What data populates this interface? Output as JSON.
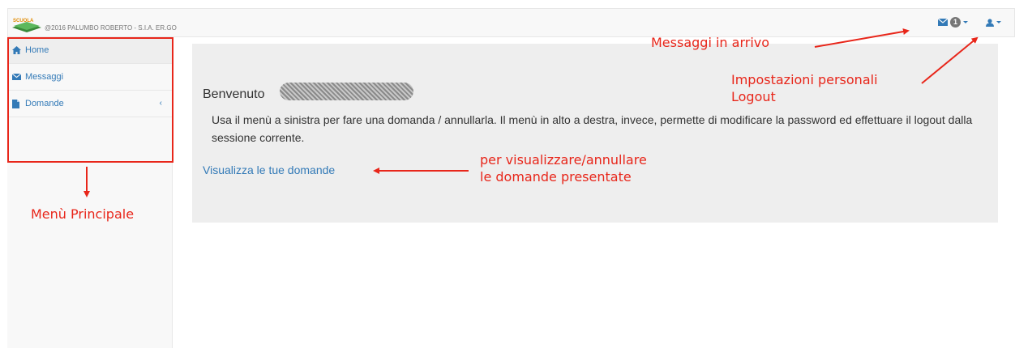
{
  "app": {
    "copyright": "@2016 PALUMBO ROBERTO - S.I.A. ER.GO",
    "logo_text": "SCUOLA"
  },
  "topnav": {
    "messages_count": "1",
    "messages_icon": "envelope-icon",
    "user_icon": "user-icon"
  },
  "sidebar": {
    "items": [
      {
        "label": "Home",
        "icon": "home-icon",
        "active": true
      },
      {
        "label": "Messaggi",
        "icon": "envelope-icon",
        "active": false
      },
      {
        "label": "Domande",
        "icon": "file-icon",
        "active": false,
        "expand_glyph": "‹"
      }
    ]
  },
  "main": {
    "welcome": "Benvenuto",
    "description": "Usa il menù a sinistra per fare una domanda / annullarla. Il menù in alto a destra, invece, permette di modificare la password ed effettuare il logout dalla sessione corrente.",
    "link": "Visualizza le tue domande"
  },
  "annotations": {
    "messages": "Messaggi in arrivo",
    "personal_line1": "Impostazioni personali",
    "personal_line2": "Logout",
    "domande_line1": "per visualizzare/annullare",
    "domande_line2": "le domande presentate",
    "menu": "Menù Principale"
  },
  "colors": {
    "accent": "#337ab7",
    "annotation": "#e8261a",
    "panel": "#eeeeee"
  }
}
